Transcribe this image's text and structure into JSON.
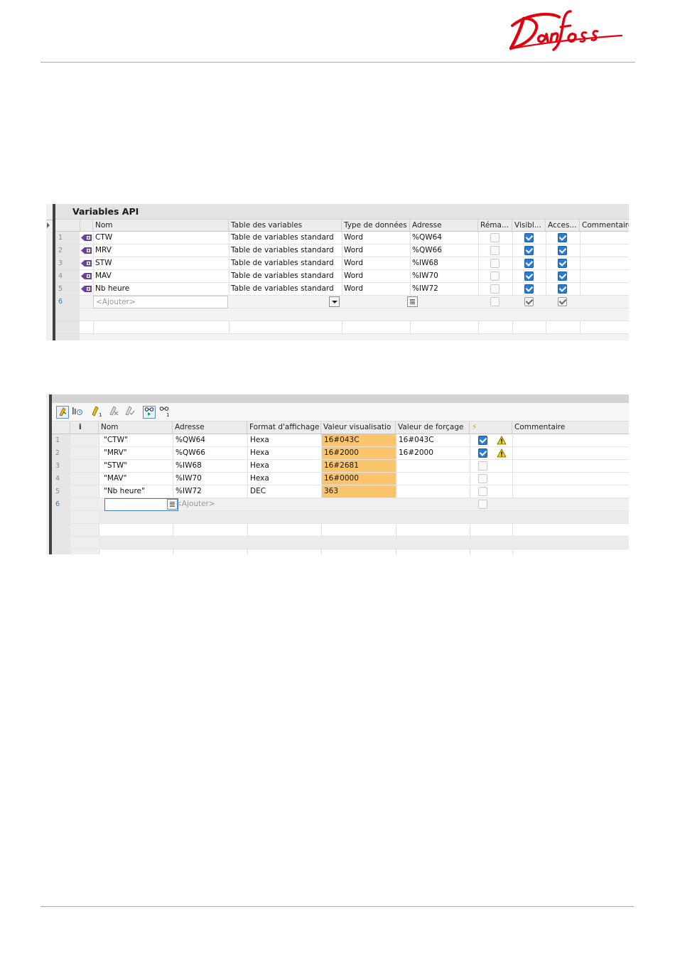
{
  "brand": {
    "logo_text": "Danfoss",
    "logo_color": "#e2000f"
  },
  "api_table": {
    "title": "Variables API",
    "columns": [
      "Nom",
      "Table des variables",
      "Type de données",
      "Adresse",
      "Réma...",
      "Visibl...",
      "Acces...",
      "Commentaire"
    ],
    "rows": [
      {
        "num": "1",
        "name": "CTW",
        "table": "Table de variables standard",
        "type": "Word",
        "address": "%QW64",
        "rema": false,
        "visible": true,
        "access": true
      },
      {
        "num": "2",
        "name": "MRV",
        "table": "Table de variables standard",
        "type": "Word",
        "address": "%QW66",
        "rema": false,
        "visible": true,
        "access": true
      },
      {
        "num": "3",
        "name": "STW",
        "table": "Table de variables standard",
        "type": "Word",
        "address": "%IW68",
        "rema": false,
        "visible": true,
        "access": true
      },
      {
        "num": "4",
        "name": "MAV",
        "table": "Table de variables standard",
        "type": "Word",
        "address": "%IW70",
        "rema": false,
        "visible": true,
        "access": true
      },
      {
        "num": "5",
        "name": "Nb heure",
        "table": "Table de variables standard",
        "type": "Word",
        "address": "%IW72",
        "rema": false,
        "visible": true,
        "access": true
      }
    ],
    "add_row": {
      "num": "6",
      "placeholder": "<Ajouter>"
    }
  },
  "watch_table": {
    "toolbar_icons": [
      "modify-values-icon",
      "monitor-once-icon",
      "modify-now-icon",
      "force-icon",
      "unforce-icon",
      "monitor-all-icon",
      "monitor-once-icon-2"
    ],
    "columns": [
      "i",
      "Nom",
      "Adresse",
      "Format d'affichage",
      "Valeur visualisatio",
      "Valeur de forçage",
      "⚡",
      "Commentaire"
    ],
    "rows": [
      {
        "num": "1",
        "name": "\"CTW\"",
        "address": "%QW64",
        "format": "Hexa",
        "value": "16#043C",
        "force": "16#043C",
        "checked": true,
        "warning": true
      },
      {
        "num": "2",
        "name": "\"MRV\"",
        "address": "%QW66",
        "format": "Hexa",
        "value": "16#2000",
        "force": "16#2000",
        "checked": true,
        "warning": true
      },
      {
        "num": "3",
        "name": "\"STW\"",
        "address": "%IW68",
        "format": "Hexa",
        "value": "16#2681",
        "force": "",
        "checked": false,
        "warning": false
      },
      {
        "num": "4",
        "name": "\"MAV\"",
        "address": "%IW70",
        "format": "Hexa",
        "value": "16#0000",
        "force": "",
        "checked": false,
        "warning": false
      },
      {
        "num": "5",
        "name": "\"Nb heure\"",
        "address": "%IW72",
        "format": "DEC",
        "value": "363",
        "force": "",
        "checked": false,
        "warning": false
      }
    ],
    "add_row": {
      "num": "6",
      "placeholder": "<Ajouter>"
    }
  }
}
